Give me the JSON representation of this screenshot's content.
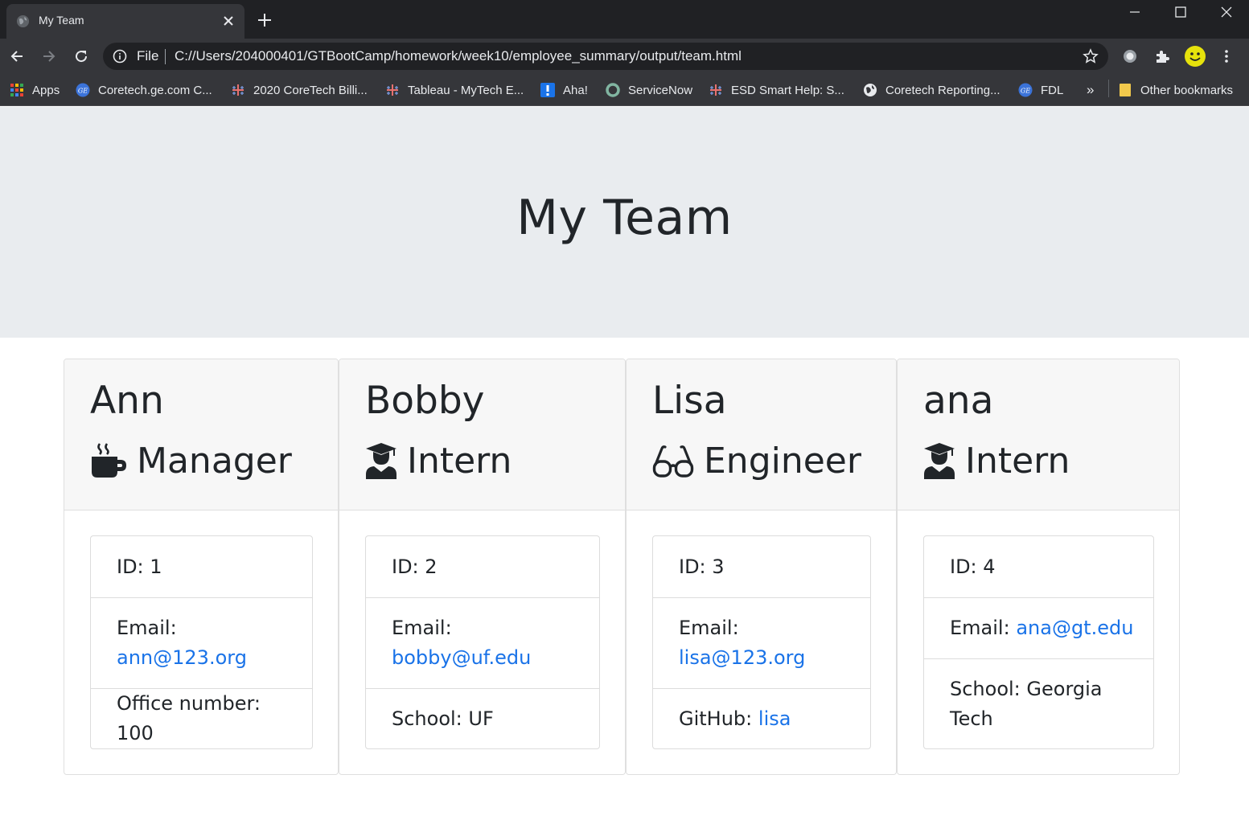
{
  "browser": {
    "tab_title": "My Team",
    "omnibox_scheme": "File",
    "url": "C://Users/204000401/GTBootCamp/homework/week10/employee_summary/output/team.html",
    "bookmarks": [
      {
        "label": "Apps",
        "icon": "apps-grid-icon"
      },
      {
        "label": "Coretech.ge.com C...",
        "icon": "ge-logo-icon"
      },
      {
        "label": "2020 CoreTech Billi...",
        "icon": "tableau-icon"
      },
      {
        "label": "Tableau - MyTech E...",
        "icon": "tableau-icon"
      },
      {
        "label": "Aha!",
        "icon": "aha-icon"
      },
      {
        "label": "ServiceNow",
        "icon": "servicenow-icon"
      },
      {
        "label": "ESD Smart Help: S...",
        "icon": "tableau-icon"
      },
      {
        "label": "Coretech Reporting...",
        "icon": "globe-icon"
      },
      {
        "label": "FDL",
        "icon": "ge-logo-icon"
      }
    ],
    "overflow_label": "»",
    "other_bookmarks": "Other bookmarks"
  },
  "page": {
    "title": "My Team"
  },
  "employees": [
    {
      "name": "Ann",
      "role": "Manager",
      "role_icon": "coffee-mug-icon",
      "id_label": "ID: 1",
      "email_label": "Email:",
      "email": "ann@123.org",
      "extra_label": "Office number: 100",
      "extra_link": ""
    },
    {
      "name": "Bobby",
      "role": "Intern",
      "role_icon": "graduate-icon",
      "id_label": "ID: 2",
      "email_label": "Email:",
      "email": "bobby@uf.edu",
      "extra_label": "School: UF",
      "extra_link": ""
    },
    {
      "name": "Lisa",
      "role": "Engineer",
      "role_icon": "glasses-icon",
      "id_label": "ID: 3",
      "email_label": "Email:",
      "email": "lisa@123.org",
      "extra_label": "GitHub:",
      "extra_link": "lisa"
    },
    {
      "name": "ana",
      "role": "Intern",
      "role_icon": "graduate-icon",
      "id_label": "ID: 4",
      "email_label": "Email:",
      "email": "ana@gt.edu",
      "extra_label": "School: Georgia Tech",
      "extra_link": ""
    }
  ]
}
